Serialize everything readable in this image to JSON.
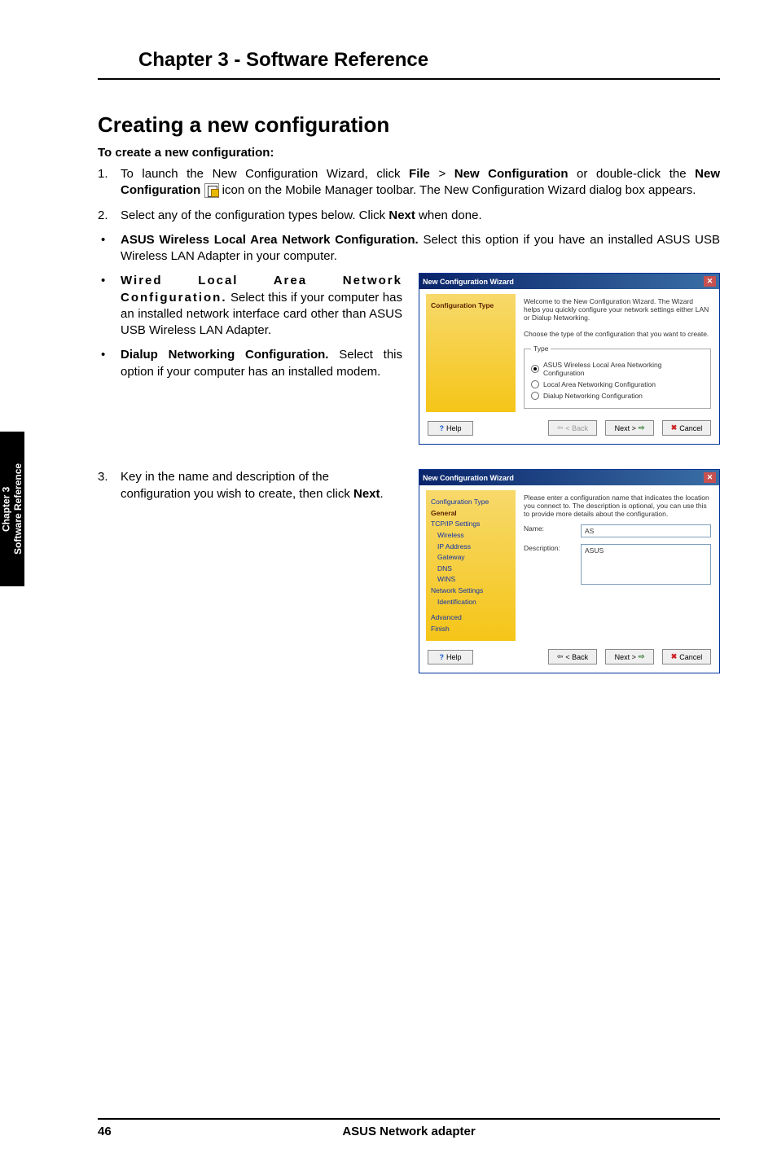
{
  "chapter_title": "Chapter 3 - Software Reference",
  "section_title": "Creating a new configuration",
  "subheading": "To create a new configuration:",
  "step1_num": "1.",
  "step1_a": "To launch the New Configuration Wizard, click ",
  "step1_b": "File",
  "step1_c": " > ",
  "step1_d": "New Configuration",
  "step1_e": " or double-click the ",
  "step1_f": "New Configuration",
  "step1_g": " icon on the Mobile Manager toolbar. The New Configuration Wizard dialog box appears.",
  "step2_num": "2.",
  "step2_a": "Select any of the configuration types below. Click ",
  "step2_b": "Next",
  "step2_c": " when done.",
  "bullet_dot": "•",
  "bul1_a": "ASUS Wireless Local Area Network Configuration.",
  "bul1_b": " Select this option if you have an installed ASUS USB Wireless LAN Adapter in your computer.",
  "bul2_a": "Wired Local Area Network Configuration.",
  "bul2_b": " Select this if your computer has an installed network interface card other than ASUS USB Wireless LAN Adapter.",
  "bul3_a": "Dialup Networking Configuration.",
  "bul3_b": " Select this option if your computer has an installed modem.",
  "step3_num": "3.",
  "step3_a": "Key in the name and description of the configuration you wish to create, then click ",
  "step3_b": "Next",
  "step3_c": ".",
  "dlg1": {
    "title": "New Configuration Wizard",
    "sidebar_active": "Configuration Type",
    "welcome": "Welcome to the New Configuration Wizard. The Wizard helps you quickly configure your network settings either LAN or Dialup Networking.",
    "choose": "Choose the type of the configuration that you want to create.",
    "type_legend": "Type",
    "opt1": "ASUS Wireless Local Area Networking Configuration",
    "opt2": "Local Area Networking Configuration",
    "opt3": "Dialup Networking Configuration",
    "help": "Help",
    "back": "< Back",
    "next": "Next >",
    "cancel": "Cancel"
  },
  "dlg2": {
    "title": "New Configuration Wizard",
    "nav": {
      "config_type": "Configuration Type",
      "general": "General",
      "tcpip": "TCP/IP Settings",
      "wireless": "Wireless",
      "ip": "IP Address",
      "gateway": "Gateway",
      "dns": "DNS",
      "wins": "WINS",
      "netset": "Network Settings",
      "ident": "Identification",
      "advanced": "Advanced",
      "finish": "Finish"
    },
    "intro": "Please enter a configuration name that indicates the location you connect to. The description is optional, you can use this to provide more details about the configuration.",
    "name_label": "Name:",
    "name_value": "AS",
    "desc_label": "Description:",
    "desc_value": "ASUS",
    "help": "Help",
    "back": "< Back",
    "next": "Next >",
    "cancel": "Cancel"
  },
  "sidetab_line1": "Chapter 3",
  "sidetab_line2": "Software Reference",
  "footer_page": "46",
  "footer_title": "ASUS Network adapter"
}
